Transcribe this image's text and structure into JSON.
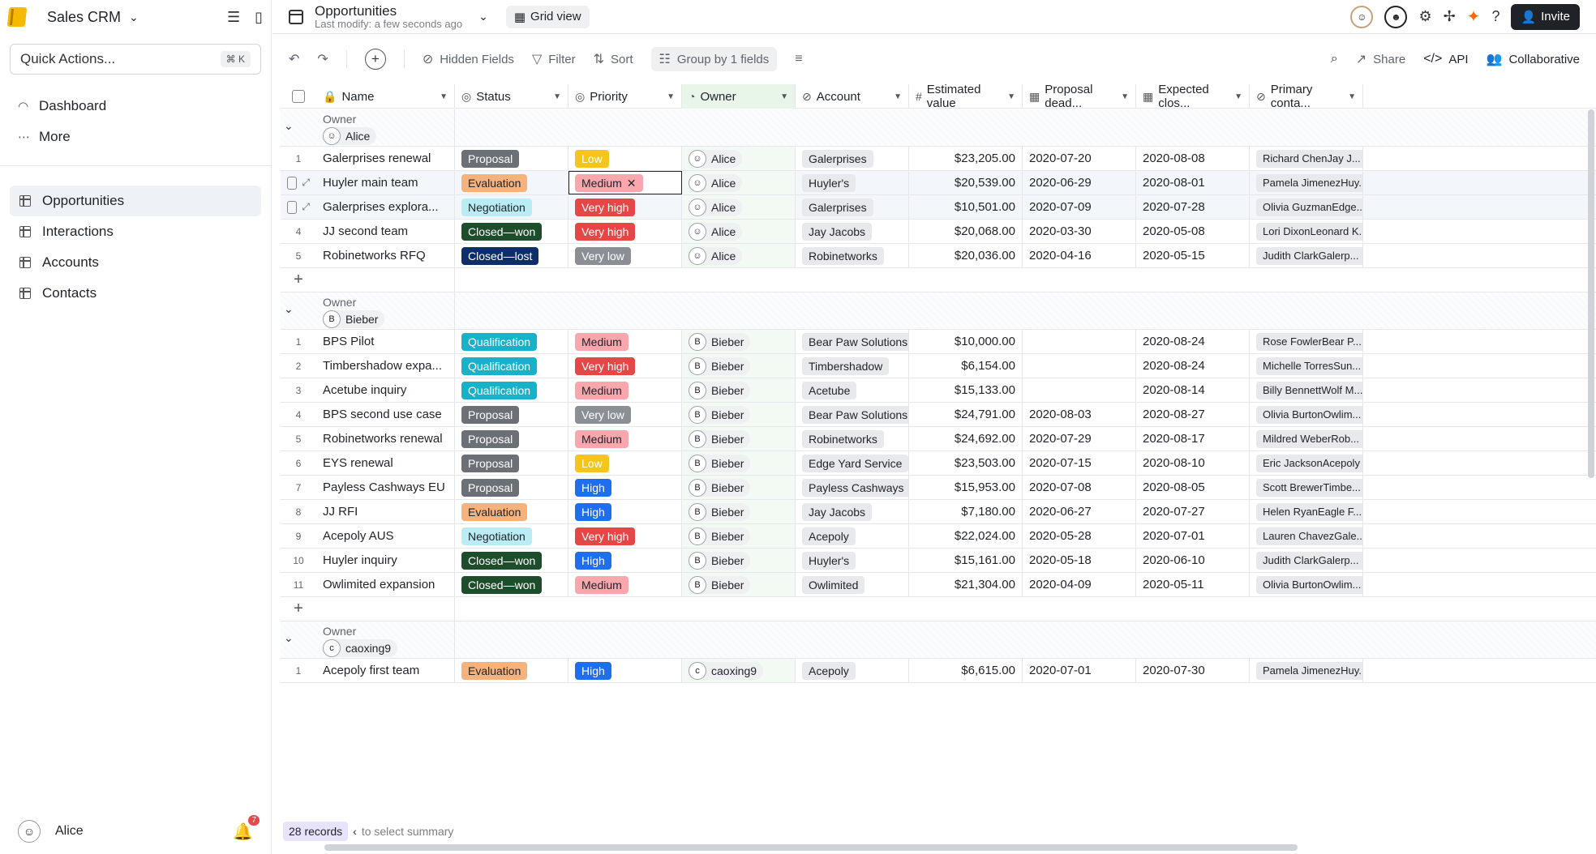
{
  "sidebar": {
    "workspace": "Sales CRM",
    "quick_actions": "Quick Actions...",
    "quick_shortcut": "⌘ K",
    "nav": [
      {
        "label": "Dashboard",
        "icon": "dashboard-icon"
      },
      {
        "label": "More",
        "icon": "more-icon"
      }
    ],
    "tables": [
      {
        "label": "Opportunities",
        "active": true
      },
      {
        "label": "Interactions",
        "active": false
      },
      {
        "label": "Accounts",
        "active": false
      },
      {
        "label": "Contacts",
        "active": false
      }
    ],
    "user": "Alice",
    "notif_count": "7"
  },
  "topbar": {
    "title": "Opportunities",
    "subtitle": "Last modify: a few seconds ago",
    "view": "Grid view",
    "invite": "Invite"
  },
  "toolbar": {
    "hidden_fields": "Hidden Fields",
    "filter": "Filter",
    "sort": "Sort",
    "group": "Group by 1 fields",
    "share": "Share",
    "api": "API",
    "collaborative": "Collaborative"
  },
  "columns": [
    "Name",
    "Status",
    "Priority",
    "Owner",
    "Account",
    "Estimated value",
    "Proposal dead...",
    "Expected clos...",
    "Primary conta..."
  ],
  "colors": {
    "Proposal": [
      "#6b6f76",
      "#ffffff"
    ],
    "Evaluation": [
      "#f6b27a",
      "#1f2328"
    ],
    "Negotiation": [
      "#b9ecf5",
      "#1f2328"
    ],
    "Closed—won": [
      "#1e4d2b",
      "#ffffff"
    ],
    "Closed—lost": [
      "#0d2d6b",
      "#ffffff"
    ],
    "Qualification": [
      "#17b1c9",
      "#ffffff"
    ],
    "Low": [
      "#f5c518",
      "#ffffff"
    ],
    "Medium": [
      "#f9a7ad",
      "#1f2328"
    ],
    "Very high": [
      "#e54646",
      "#ffffff"
    ],
    "Very low": [
      "#8a8f96",
      "#ffffff"
    ],
    "High": [
      "#1e6ff0",
      "#ffffff"
    ]
  },
  "group_label": "Owner",
  "groups": [
    {
      "owner": "Alice",
      "initial": "☺",
      "rows": [
        {
          "n": "1",
          "name": "Galerprises renewal",
          "status": "Proposal",
          "priority": "Low",
          "account": "Galerprises",
          "value": "$23,205.00",
          "deadline": "2020-07-20",
          "close": "2020-08-08",
          "contact": "Richard ChenJay J..."
        },
        {
          "n": "",
          "name": "Huyler main team",
          "status": "Evaluation",
          "priority": "Medium",
          "account": "Huyler's",
          "value": "$20,539.00",
          "deadline": "2020-06-29",
          "close": "2020-08-01",
          "contact": "Pamela JimenezHuy...",
          "selected": true
        },
        {
          "n": "",
          "name": "Galerprises explora...",
          "status": "Negotiation",
          "priority": "Very high",
          "account": "Galerprises",
          "value": "$10,501.00",
          "deadline": "2020-07-09",
          "close": "2020-07-28",
          "contact": "Olivia GuzmanEdge...",
          "hover": true
        },
        {
          "n": "4",
          "name": "JJ second team",
          "status": "Closed—won",
          "priority": "Very high",
          "account": "Jay Jacobs",
          "value": "$20,068.00",
          "deadline": "2020-03-30",
          "close": "2020-05-08",
          "contact": "Lori DixonLeonard K..."
        },
        {
          "n": "5",
          "name": "Robinetworks RFQ",
          "status": "Closed—lost",
          "priority": "Very low",
          "account": "Robinetworks",
          "value": "$20,036.00",
          "deadline": "2020-04-16",
          "close": "2020-05-15",
          "contact": "Judith ClarkGalerp..."
        }
      ]
    },
    {
      "owner": "Bieber",
      "initial": "B",
      "rows": [
        {
          "n": "1",
          "name": "BPS Pilot",
          "status": "Qualification",
          "priority": "Medium",
          "account": "Bear Paw Solutions",
          "value": "$10,000.00",
          "deadline": "",
          "close": "2020-08-24",
          "contact": "Rose FowlerBear P..."
        },
        {
          "n": "2",
          "name": "Timbershadow expa...",
          "status": "Qualification",
          "priority": "Very high",
          "account": "Timbershadow",
          "value": "$6,154.00",
          "deadline": "",
          "close": "2020-08-24",
          "contact": "Michelle TorresSun..."
        },
        {
          "n": "3",
          "name": "Acetube inquiry",
          "status": "Qualification",
          "priority": "Medium",
          "account": "Acetube",
          "value": "$15,133.00",
          "deadline": "",
          "close": "2020-08-14",
          "contact": "Billy BennettWolf M..."
        },
        {
          "n": "4",
          "name": "BPS second use case",
          "status": "Proposal",
          "priority": "Very low",
          "account": "Bear Paw Solutions",
          "value": "$24,791.00",
          "deadline": "2020-08-03",
          "close": "2020-08-27",
          "contact": "Olivia BurtonOwlim..."
        },
        {
          "n": "5",
          "name": "Robinetworks renewal",
          "status": "Proposal",
          "priority": "Medium",
          "account": "Robinetworks",
          "value": "$24,692.00",
          "deadline": "2020-07-29",
          "close": "2020-08-17",
          "contact": "Mildred WeberRob..."
        },
        {
          "n": "6",
          "name": "EYS renewal",
          "status": "Proposal",
          "priority": "Low",
          "account": "Edge Yard Service",
          "value": "$23,503.00",
          "deadline": "2020-07-15",
          "close": "2020-08-10",
          "contact": "Eric JacksonAcepoly"
        },
        {
          "n": "7",
          "name": "Payless Cashways EU",
          "status": "Proposal",
          "priority": "High",
          "account": "Payless Cashways",
          "value": "$15,953.00",
          "deadline": "2020-07-08",
          "close": "2020-08-05",
          "contact": "Scott BrewerTimbe..."
        },
        {
          "n": "8",
          "name": "JJ RFI",
          "status": "Evaluation",
          "priority": "High",
          "account": "Jay Jacobs",
          "value": "$7,180.00",
          "deadline": "2020-06-27",
          "close": "2020-07-27",
          "contact": "Helen RyanEagle F..."
        },
        {
          "n": "9",
          "name": "Acepoly AUS",
          "status": "Negotiation",
          "priority": "Very high",
          "account": "Acepoly",
          "value": "$22,024.00",
          "deadline": "2020-05-28",
          "close": "2020-07-01",
          "contact": "Lauren ChavezGale..."
        },
        {
          "n": "10",
          "name": "Huyler inquiry",
          "status": "Closed—won",
          "priority": "High",
          "account": "Huyler's",
          "value": "$15,161.00",
          "deadline": "2020-05-18",
          "close": "2020-06-10",
          "contact": "Judith ClarkGalerp..."
        },
        {
          "n": "11",
          "name": "Owlimited expansion",
          "status": "Closed—won",
          "priority": "Medium",
          "account": "Owlimited",
          "value": "$21,304.00",
          "deadline": "2020-04-09",
          "close": "2020-05-11",
          "contact": "Olivia BurtonOwlim..."
        }
      ]
    },
    {
      "owner": "caoxing9",
      "initial": "c",
      "rows": [
        {
          "n": "1",
          "name": "Acepoly first team",
          "status": "Evaluation",
          "priority": "High",
          "account": "Acepoly",
          "value": "$6,615.00",
          "deadline": "2020-07-01",
          "close": "2020-07-30",
          "contact": "Pamela JimenezHuy..."
        }
      ]
    }
  ],
  "summary": {
    "records": "28 records",
    "hint": "to select summary"
  }
}
